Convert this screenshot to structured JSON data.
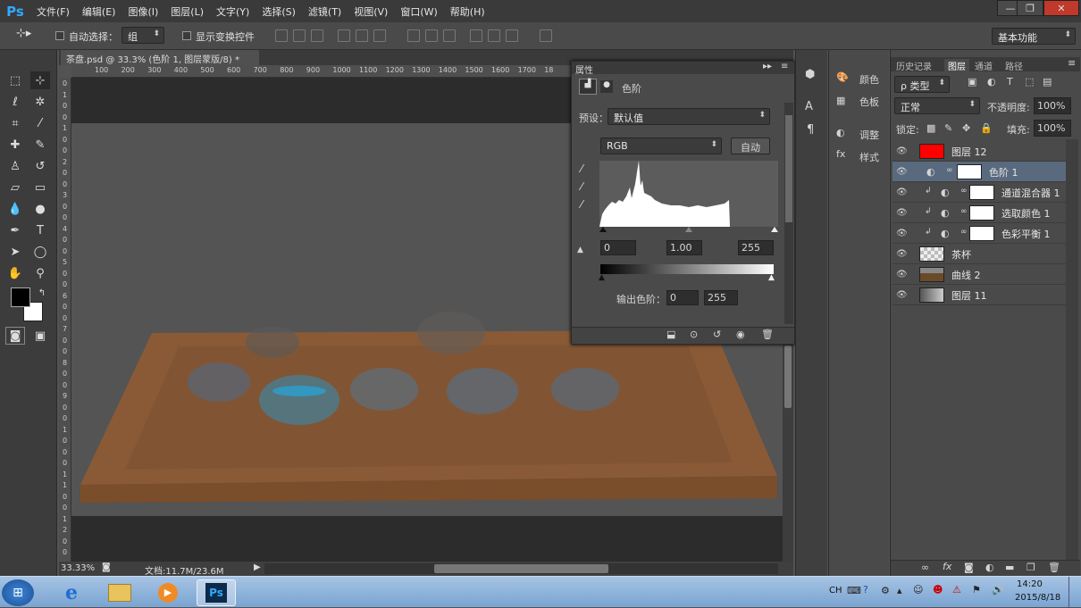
{
  "app": {
    "logo": "Ps"
  },
  "menu": [
    "文件(F)",
    "编辑(E)",
    "图像(I)",
    "图层(L)",
    "文字(Y)",
    "选择(S)",
    "滤镜(T)",
    "视图(V)",
    "窗口(W)",
    "帮助(H)"
  ],
  "window_buttons": {
    "minimize": "—",
    "restore": "❐",
    "close": "✕"
  },
  "options": {
    "auto_select_label": "自动选择：",
    "auto_select_value": "组",
    "show_transform_label": "显示变换控件",
    "workspace": "基本功能"
  },
  "document": {
    "tab_title": "茶盘.psd @ 33.3% (色阶 1, 图层蒙版/8) *",
    "zoom": "33.33%",
    "doc_info": "文档:11.7M/23.6M"
  },
  "ruler": {
    "h": [
      "100",
      "200",
      "300",
      "400",
      "500",
      "600",
      "700",
      "800",
      "900",
      "1000",
      "1100",
      "1200",
      "1300",
      "1400",
      "1500",
      "1600",
      "1700",
      "18"
    ],
    "v": [
      "0",
      "1",
      "0",
      "0",
      "1",
      "0",
      "0",
      "2",
      "0",
      "0",
      "3",
      "0",
      "0",
      "4",
      "0",
      "0",
      "5",
      "0",
      "0",
      "6",
      "0",
      "0",
      "7",
      "0",
      "0",
      "8",
      "0",
      "0",
      "9",
      "0",
      "0",
      "1",
      "0",
      "0",
      "0",
      "1",
      "1",
      "0",
      "0",
      "1",
      "2",
      "0",
      "0"
    ]
  },
  "properties": {
    "panel_title": "属性",
    "type_label": "色阶",
    "preset_label": "预设：",
    "preset_value": "默认值",
    "channel": "RGB",
    "auto_button": "自动",
    "input_black": "0",
    "input_gamma": "1.00",
    "input_white": "255",
    "output_label": "输出色阶：",
    "output_black": "0",
    "output_white": "255"
  },
  "dock": {
    "color": "颜色",
    "swatches": "色板",
    "adjustments": "调整",
    "styles": "样式"
  },
  "layers_panel": {
    "tabs": [
      "历史记录",
      "图层",
      "通道",
      "路径"
    ],
    "filter_kind": "ρ 类型",
    "blend_mode": "正常",
    "opacity_label": "不透明度:",
    "opacity_value": "100%",
    "lock_label": "锁定:",
    "fill_label": "填充:",
    "fill_value": "100%",
    "layers": [
      {
        "name": "图层 12",
        "thumb": "#ff0000"
      },
      {
        "name": "色阶 1",
        "thumb": "#ffffff"
      },
      {
        "name": "通道混合器 1",
        "thumb": "#ffffff"
      },
      {
        "name": "选取颜色 1",
        "thumb": "#ffffff"
      },
      {
        "name": "色彩平衡 1",
        "thumb": "#ffffff"
      },
      {
        "name": "茶杯",
        "thumb": "#dddddd"
      },
      {
        "name": "曲线 2",
        "thumb": "#6b4a2a"
      },
      {
        "name": "图层 11",
        "thumb": "#9a9a9a"
      }
    ]
  },
  "taskbar": {
    "lang": "CH",
    "time": "14:20",
    "date": "2015/8/18",
    "ps_label": "Ps"
  },
  "colors": {
    "accent": "#33a8ff",
    "selected_row": "#5a6a7e",
    "tray": "#orange"
  }
}
